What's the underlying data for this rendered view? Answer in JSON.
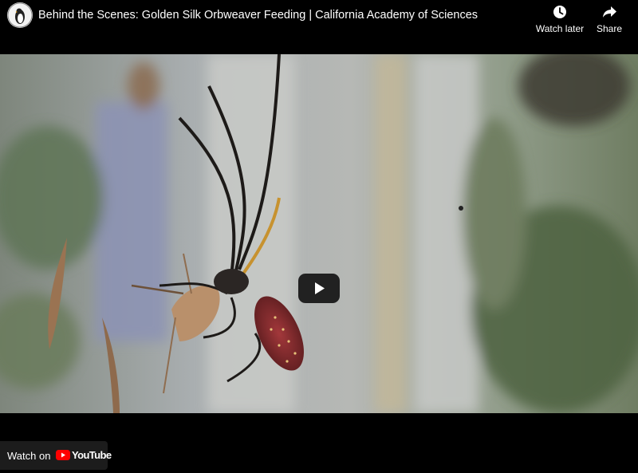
{
  "header": {
    "title": "Behind the Scenes: Golden Silk Orbweaver Feeding | California Academy of Sciences",
    "channel_avatar_icon": "penguin-logo-icon",
    "actions": [
      {
        "label": "Watch later",
        "icon": "clock-icon"
      },
      {
        "label": "Share",
        "icon": "share-arrow-icon"
      }
    ]
  },
  "player": {
    "play_icon": "play-icon",
    "play_button_color": "#212121"
  },
  "footer": {
    "watch_on_label": "Watch on",
    "brand": "YouTube",
    "brand_color": "#ff0000"
  }
}
